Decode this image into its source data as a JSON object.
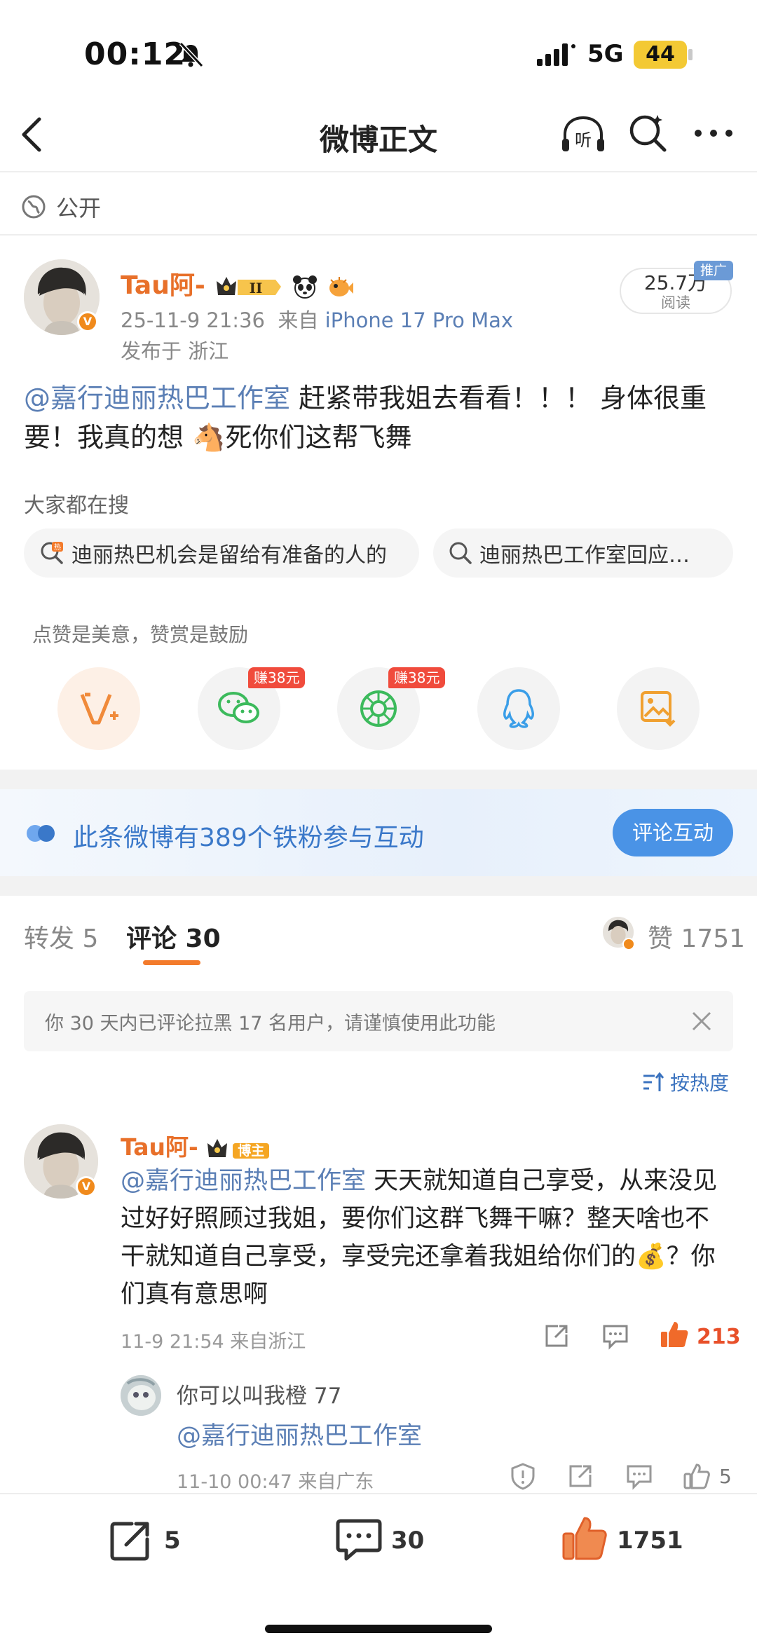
{
  "status_bar": {
    "time": "00:12",
    "network": "5G",
    "battery": "44"
  },
  "nav": {
    "title": "微博正文"
  },
  "visibility": "公开",
  "post": {
    "author": "Tau阿-",
    "level_badge": "II",
    "time": "25-11-9 21:36",
    "from_label": "来自",
    "device": "iPhone 17 Pro Max",
    "location": "发布于 浙江",
    "reads": "25.7万",
    "reads_label": "阅读",
    "promo_label": "推广",
    "mention": "@嘉行迪丽热巴工作室",
    "text_part1": " 赶紧带我姐去看看！！！ 身体很重要！我真的想",
    "emoji": "🐴",
    "text_part2": "死你们这帮飞舞"
  },
  "search": {
    "header": "大家都在搜",
    "items": [
      {
        "label": "迪丽热巴机会是留给有准备的人的",
        "icon": "hot-search-icon"
      },
      {
        "label": "迪丽热巴工作室回应…",
        "icon": "search-icon"
      }
    ]
  },
  "reward": {
    "tip": "点赞是美意，赞赏是鼓励",
    "earn_badge_1": "赚38元",
    "earn_badge_2": "赚38元"
  },
  "iron_fans": {
    "text": "此条微博有389个铁粉参与互动",
    "button": "评论互动"
  },
  "tabs": {
    "repost": "转发 5",
    "comment": "评论 30",
    "likes": "赞 1751"
  },
  "notice": {
    "text": "你 30 天内已评论拉黑 17 名用户，请谨慎使用此功能"
  },
  "sort": {
    "label": "按热度"
  },
  "comment": {
    "author": "Tau阿-",
    "badge": "博主",
    "mention": "@嘉行迪丽热巴工作室",
    "text": " 天天就知道自己享受，从来没见过好好照顾过我姐，要你们这群飞舞干嘛？整天啥也不干就知道自己享受，享受完还拿着我姐给你们的",
    "emoji": "💰",
    "text_end": "？你们真有意思啊",
    "time": "11-9 21:54  来自浙江",
    "likes": "213"
  },
  "reply": {
    "author": "你可以叫我橙 77",
    "text": "@嘉行迪丽热巴工作室",
    "time": "11-10 00:47  来自广东",
    "likes": "5"
  },
  "bottom_bar": {
    "reposts": "5",
    "comments": "30",
    "likes": "1751"
  },
  "colors": {
    "accent": "#f37b2c",
    "link": "#5b7fb5",
    "author": "#e8702a",
    "iron_fan_button": "#4a93e6"
  }
}
